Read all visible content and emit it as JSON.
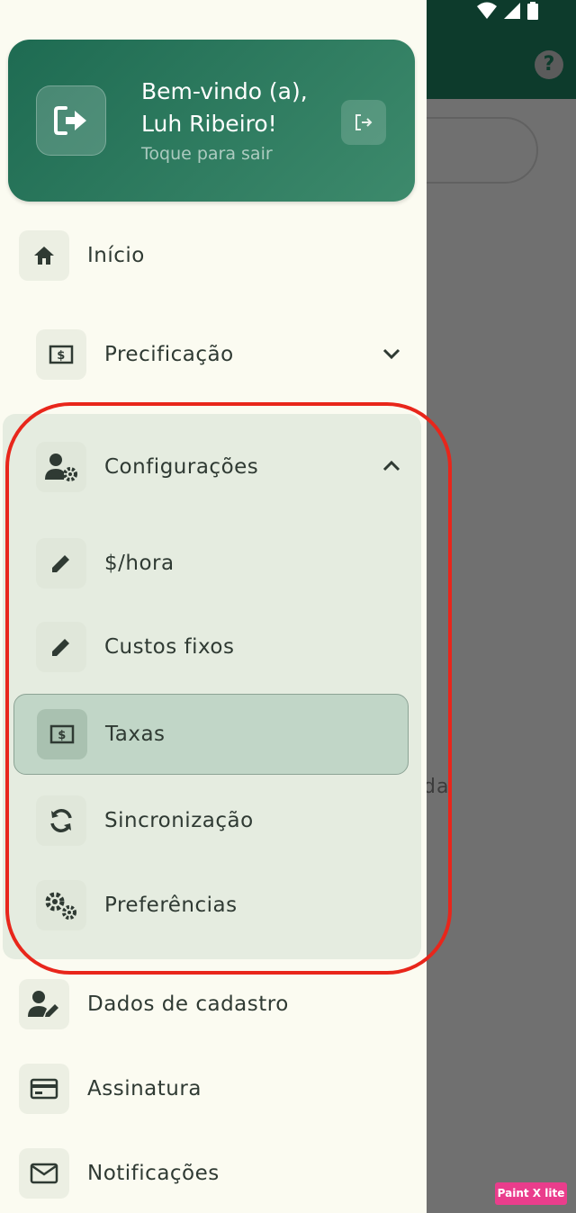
{
  "header": {
    "greeting": "Bem-vindo (a),",
    "username": "Luh Ribeiro!",
    "subtitle": "Toque para sair",
    "accent_color": "#1e6b52"
  },
  "menu": {
    "inicio": "Início",
    "precificacao": "Precificação",
    "configuracoes": "Configurações",
    "sub": {
      "hora": "$/hora",
      "custos": "Custos fixos",
      "taxas": "Taxas",
      "sincronizacao": "Sincronização",
      "preferencias": "Preferências"
    },
    "dados": "Dados de cadastro",
    "assinatura": "Assinatura",
    "notificacoes": "Notificações"
  },
  "background": {
    "help_glyph": "?",
    "text_fragment": "da"
  },
  "watermark": "Paint X lite",
  "colors": {
    "selected_bg": "#c1d6c7",
    "annotation_outline": "#e8261b"
  }
}
